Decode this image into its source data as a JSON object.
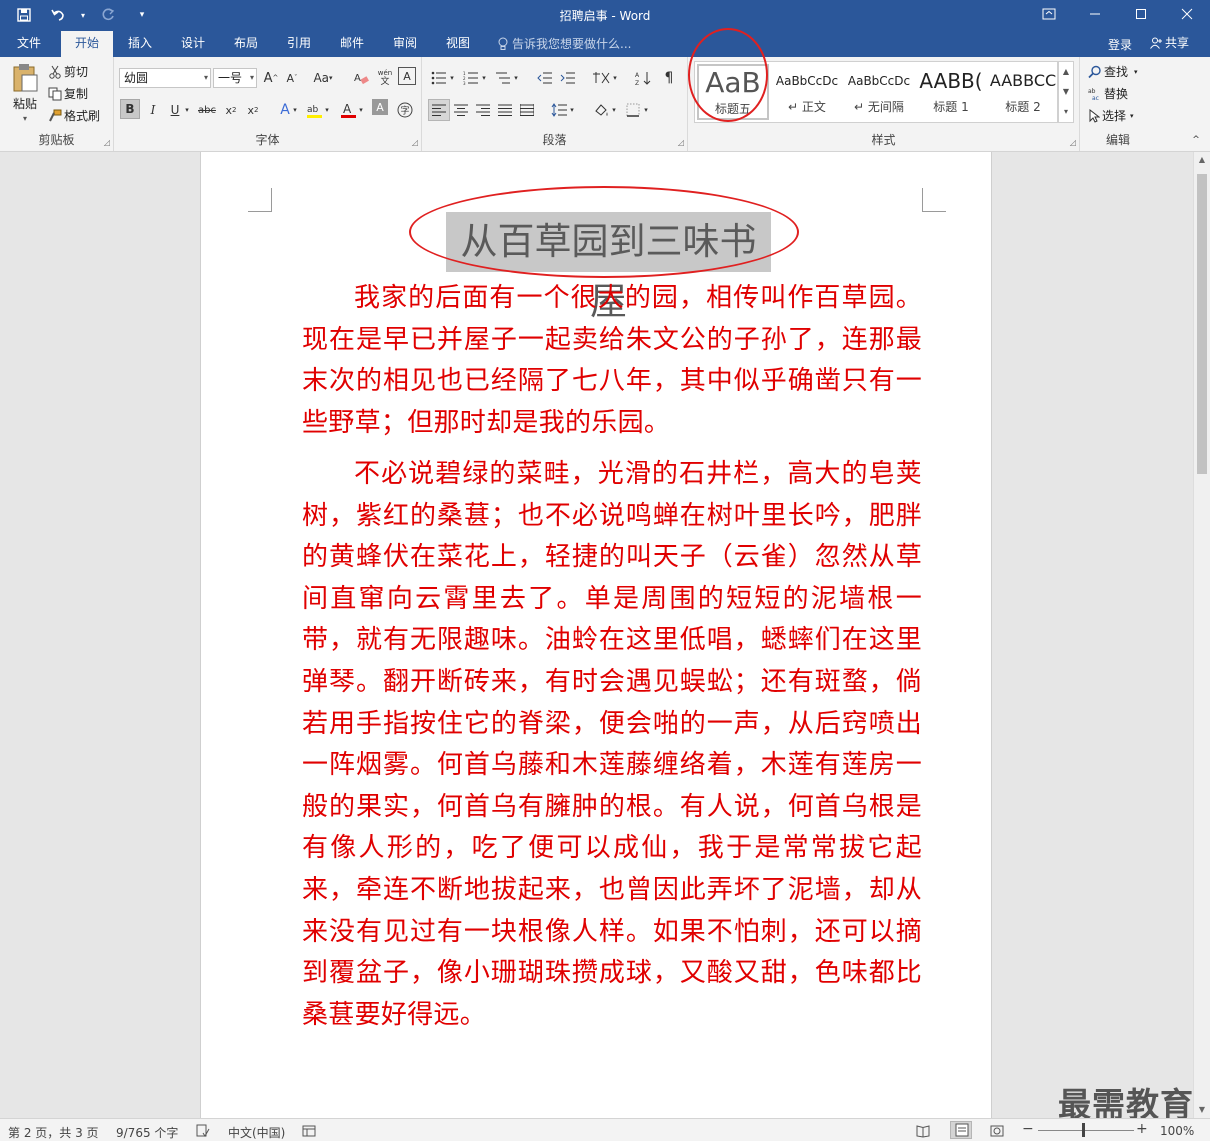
{
  "window": {
    "title": "招聘启事 - Word",
    "min_icon": "minimize-icon",
    "max_icon": "maximize-icon",
    "close_icon": "close-icon"
  },
  "tabs": {
    "file": "文件",
    "home": "开始",
    "insert": "插入",
    "design": "设计",
    "layout": "布局",
    "references": "引用",
    "mailings": "邮件",
    "review": "审阅",
    "view": "视图",
    "tell_me": "告诉我您想要做什么...",
    "login": "登录",
    "share": "共享"
  },
  "clipboard": {
    "paste": "粘贴",
    "cut": "剪切",
    "copy": "复制",
    "format_painter": "格式刷",
    "label": "剪贴板"
  },
  "font": {
    "name": "幼圆",
    "size": "一号",
    "change_case": "Aa",
    "label": "字体"
  },
  "paragraph": {
    "label": "段落"
  },
  "styles": {
    "label": "样式",
    "items": [
      {
        "preview": "AaB",
        "name": "标题五"
      },
      {
        "preview": "AaBbCcDc",
        "name": "正文"
      },
      {
        "preview": "AaBbCcDc",
        "name": "无间隔"
      },
      {
        "preview": "AABB(",
        "name": "标题 1"
      },
      {
        "preview": "AABBCC",
        "name": "标题 2"
      }
    ]
  },
  "editing": {
    "find": "查找",
    "replace": "替换",
    "select": "选择",
    "label": "编辑"
  },
  "document": {
    "title": "从百草园到三味书屋",
    "paragraphs": [
      "我家的后面有一个很大的园，相传叫作百草园。现在是早已并屋子一起卖给朱文公的子孙了，连那最末次的相见也已经隔了七八年，其中似乎确凿只有一些野草；但那时却是我的乐园。",
      "不必说碧绿的菜畦，光滑的石井栏，高大的皂荚树，紫红的桑葚；也不必说鸣蝉在树叶里长吟，肥胖的黄蜂伏在菜花上，轻捷的叫天子（云雀）忽然从草间直窜向云霄里去了。单是周围的短短的泥墙根一带，就有无限趣味。油蛉在这里低唱，蟋蟀们在这里弹琴。翻开断砖来，有时会遇见蜈蚣；还有斑蝥，倘若用手指按住它的脊梁，便会啪的一声，从后窍喷出一阵烟雾。何首乌藤和木莲藤缠络着，木莲有莲房一般的果实，何首乌有臃肿的根。有人说，何首乌根是有像人形的，吃了便可以成仙，我于是常常拔它起来，牵连不断地拔起来，也曾因此弄坏了泥墙，却从来没有见过有一块根像人样。如果不怕刺，还可以摘到覆盆子，像小珊瑚珠攒成球，又酸又甜，色味都比桑葚要好得远。"
    ]
  },
  "status": {
    "page": "第 2 页，共 3 页",
    "words": "9/765 个字",
    "language": "中文(中国)",
    "zoom": "100%"
  },
  "watermark": "最需教育",
  "colors": {
    "accent": "#2b579a",
    "text_red": "#e00000",
    "annotation": "#e02020"
  }
}
